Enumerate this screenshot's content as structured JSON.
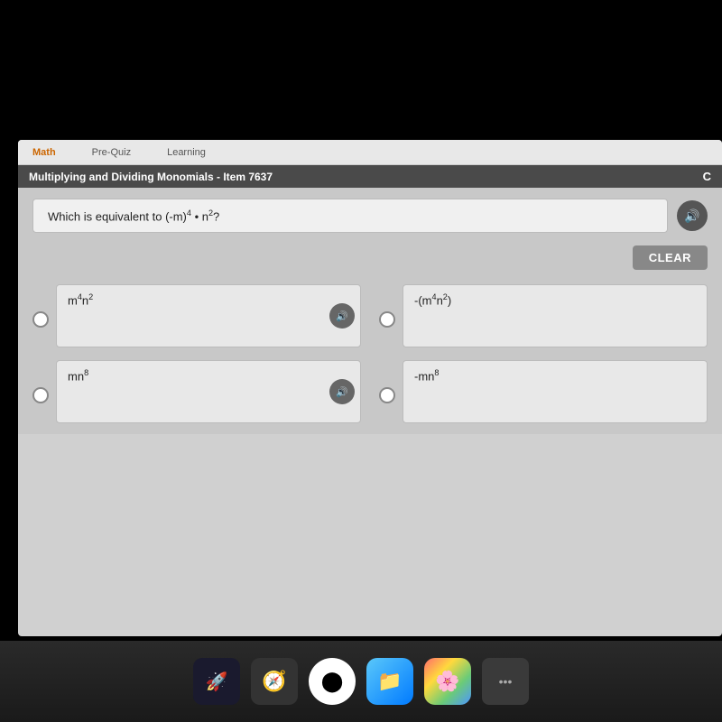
{
  "nav": {
    "math_label": "Math",
    "prequiz_label": "Pre-Quiz",
    "learning_label": "Learning"
  },
  "titlebar": {
    "title": "Multiplying and Dividing Monomials - Item 7637",
    "c_label": "C"
  },
  "question": {
    "text": "Which is equivalent to (-m)⁴ • n²?",
    "speaker_icon": "🔊"
  },
  "actions": {
    "clear_label": "CLEAR"
  },
  "answers": [
    {
      "id": "A",
      "label": "m⁴n²",
      "has_speaker": true
    },
    {
      "id": "B",
      "label": "-(m⁴n²)",
      "has_speaker": false
    },
    {
      "id": "C",
      "label": "mn⁸",
      "has_speaker": true
    },
    {
      "id": "D",
      "label": "-mn⁸",
      "has_speaker": false
    }
  ],
  "dock": {
    "items": [
      "🚀",
      "🧭",
      "⬤",
      "📁",
      "🖼️",
      "•••"
    ]
  }
}
